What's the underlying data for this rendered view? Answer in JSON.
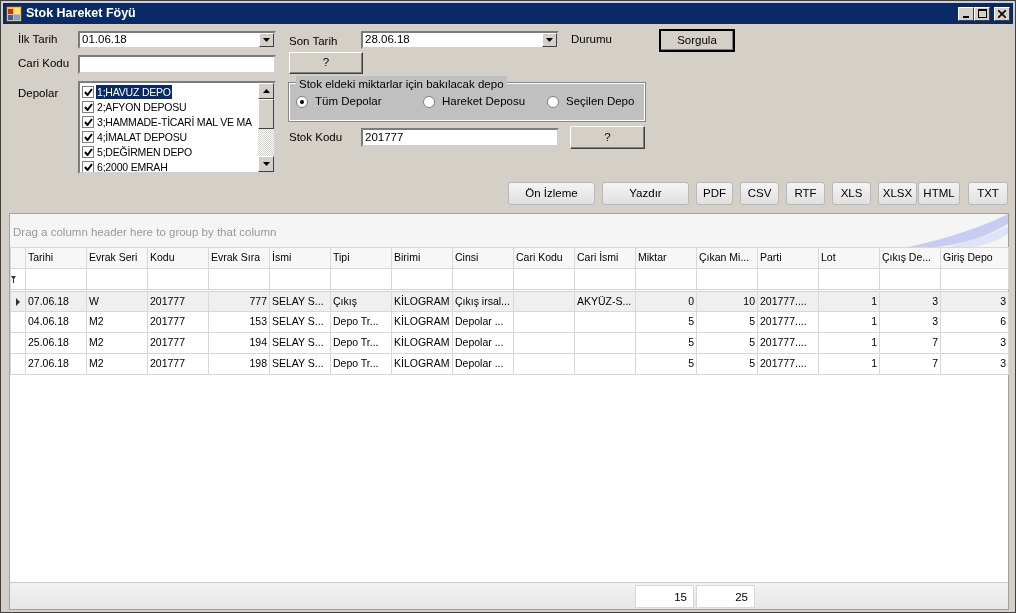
{
  "window": {
    "title": "Stok Hareket Föyü"
  },
  "form": {
    "ilk_tarih": {
      "label": "İlk Tarih",
      "value": "01.06.18"
    },
    "son_tarih": {
      "label": "Son Tarih",
      "value": "28.06.18"
    },
    "durumu": {
      "label": "Durumu"
    },
    "sorgula": "Sorgula",
    "cari_kodu": {
      "label": "Cari Kodu",
      "button": "?"
    },
    "depolar": {
      "label": "Depolar",
      "items": [
        {
          "text": "1;HAVUZ DEPO",
          "checked": true,
          "selected": true
        },
        {
          "text": "2;AFYON DEPOSU",
          "checked": true,
          "selected": false
        },
        {
          "text": "3;HAMMADE-TİCARİ MAL VE MA",
          "checked": true,
          "selected": false
        },
        {
          "text": "4;İMALAT DEPOSU",
          "checked": true,
          "selected": false
        },
        {
          "text": "5;DEĞİRMEN DEPO",
          "checked": true,
          "selected": false
        },
        {
          "text": "6;2000 EMRAH",
          "checked": true,
          "selected": false
        }
      ]
    },
    "depo_group": {
      "title": "Stok eldeki miktarlar için bakılacak depo",
      "options": [
        {
          "label": "Tüm Depolar",
          "selected": true
        },
        {
          "label": "Hareket Deposu",
          "selected": false
        },
        {
          "label": "Seçilen Depo",
          "selected": false
        }
      ]
    },
    "stok_kodu": {
      "label": "Stok Kodu",
      "value": "201777",
      "button": "?"
    }
  },
  "toolbar": [
    "Ön İzleme",
    "Yazdır",
    "PDF",
    "CSV",
    "RTF",
    "XLS",
    "XLSX",
    "HTML",
    "TXT"
  ],
  "grid": {
    "group_hint": "Drag a column header here to group by that column",
    "columns": [
      {
        "title": "Tarihi",
        "kind": "text"
      },
      {
        "title": "Evrak Seri",
        "kind": "text"
      },
      {
        "title": "Kodu",
        "kind": "text"
      },
      {
        "title": "Evrak Sıra",
        "kind": "number"
      },
      {
        "title": "İsmi",
        "kind": "text"
      },
      {
        "title": "Tipi",
        "kind": "text"
      },
      {
        "title": "Birimi",
        "kind": "text"
      },
      {
        "title": "Cinsi",
        "kind": "text"
      },
      {
        "title": "Cari Kodu",
        "kind": "text"
      },
      {
        "title": "Cari İsmi",
        "kind": "text"
      },
      {
        "title": "Miktar",
        "kind": "number",
        "total": "15"
      },
      {
        "title": "Çıkan Mi...",
        "kind": "number",
        "total": "25"
      },
      {
        "title": "Parti",
        "kind": "text"
      },
      {
        "title": "Lot",
        "kind": "number"
      },
      {
        "title": "Çıkış De...",
        "kind": "number"
      },
      {
        "title": "Giriş Depo",
        "kind": "number"
      }
    ],
    "rows": [
      {
        "selected": true,
        "cells": [
          "07.06.18",
          "W",
          "201777",
          "777",
          "SELAY S...",
          "Çıkış",
          "KİLOGRAM",
          "Çıkış irsal...",
          "",
          "AKYÜZ-S...",
          "0",
          "10",
          "201777....",
          "1",
          "3",
          "3"
        ]
      },
      {
        "selected": false,
        "cells": [
          "04.06.18",
          "M2",
          "201777",
          "153",
          "SELAY S...",
          "Depo Tr...",
          "KİLOGRAM",
          "Depolar ...",
          "",
          "",
          "5",
          "5",
          "201777....",
          "1",
          "3",
          "6"
        ]
      },
      {
        "selected": false,
        "cells": [
          "25.06.18",
          "M2",
          "201777",
          "194",
          "SELAY S...",
          "Depo Tr...",
          "KİLOGRAM",
          "Depolar ...",
          "",
          "",
          "5",
          "5",
          "201777....",
          "1",
          "7",
          "3"
        ]
      },
      {
        "selected": false,
        "cells": [
          "27.06.18",
          "M2",
          "201777",
          "198",
          "SELAY S...",
          "Depo Tr...",
          "KİLOGRAM",
          "Depolar ...",
          "",
          "",
          "5",
          "5",
          "201777....",
          "1",
          "7",
          "3"
        ]
      }
    ]
  }
}
